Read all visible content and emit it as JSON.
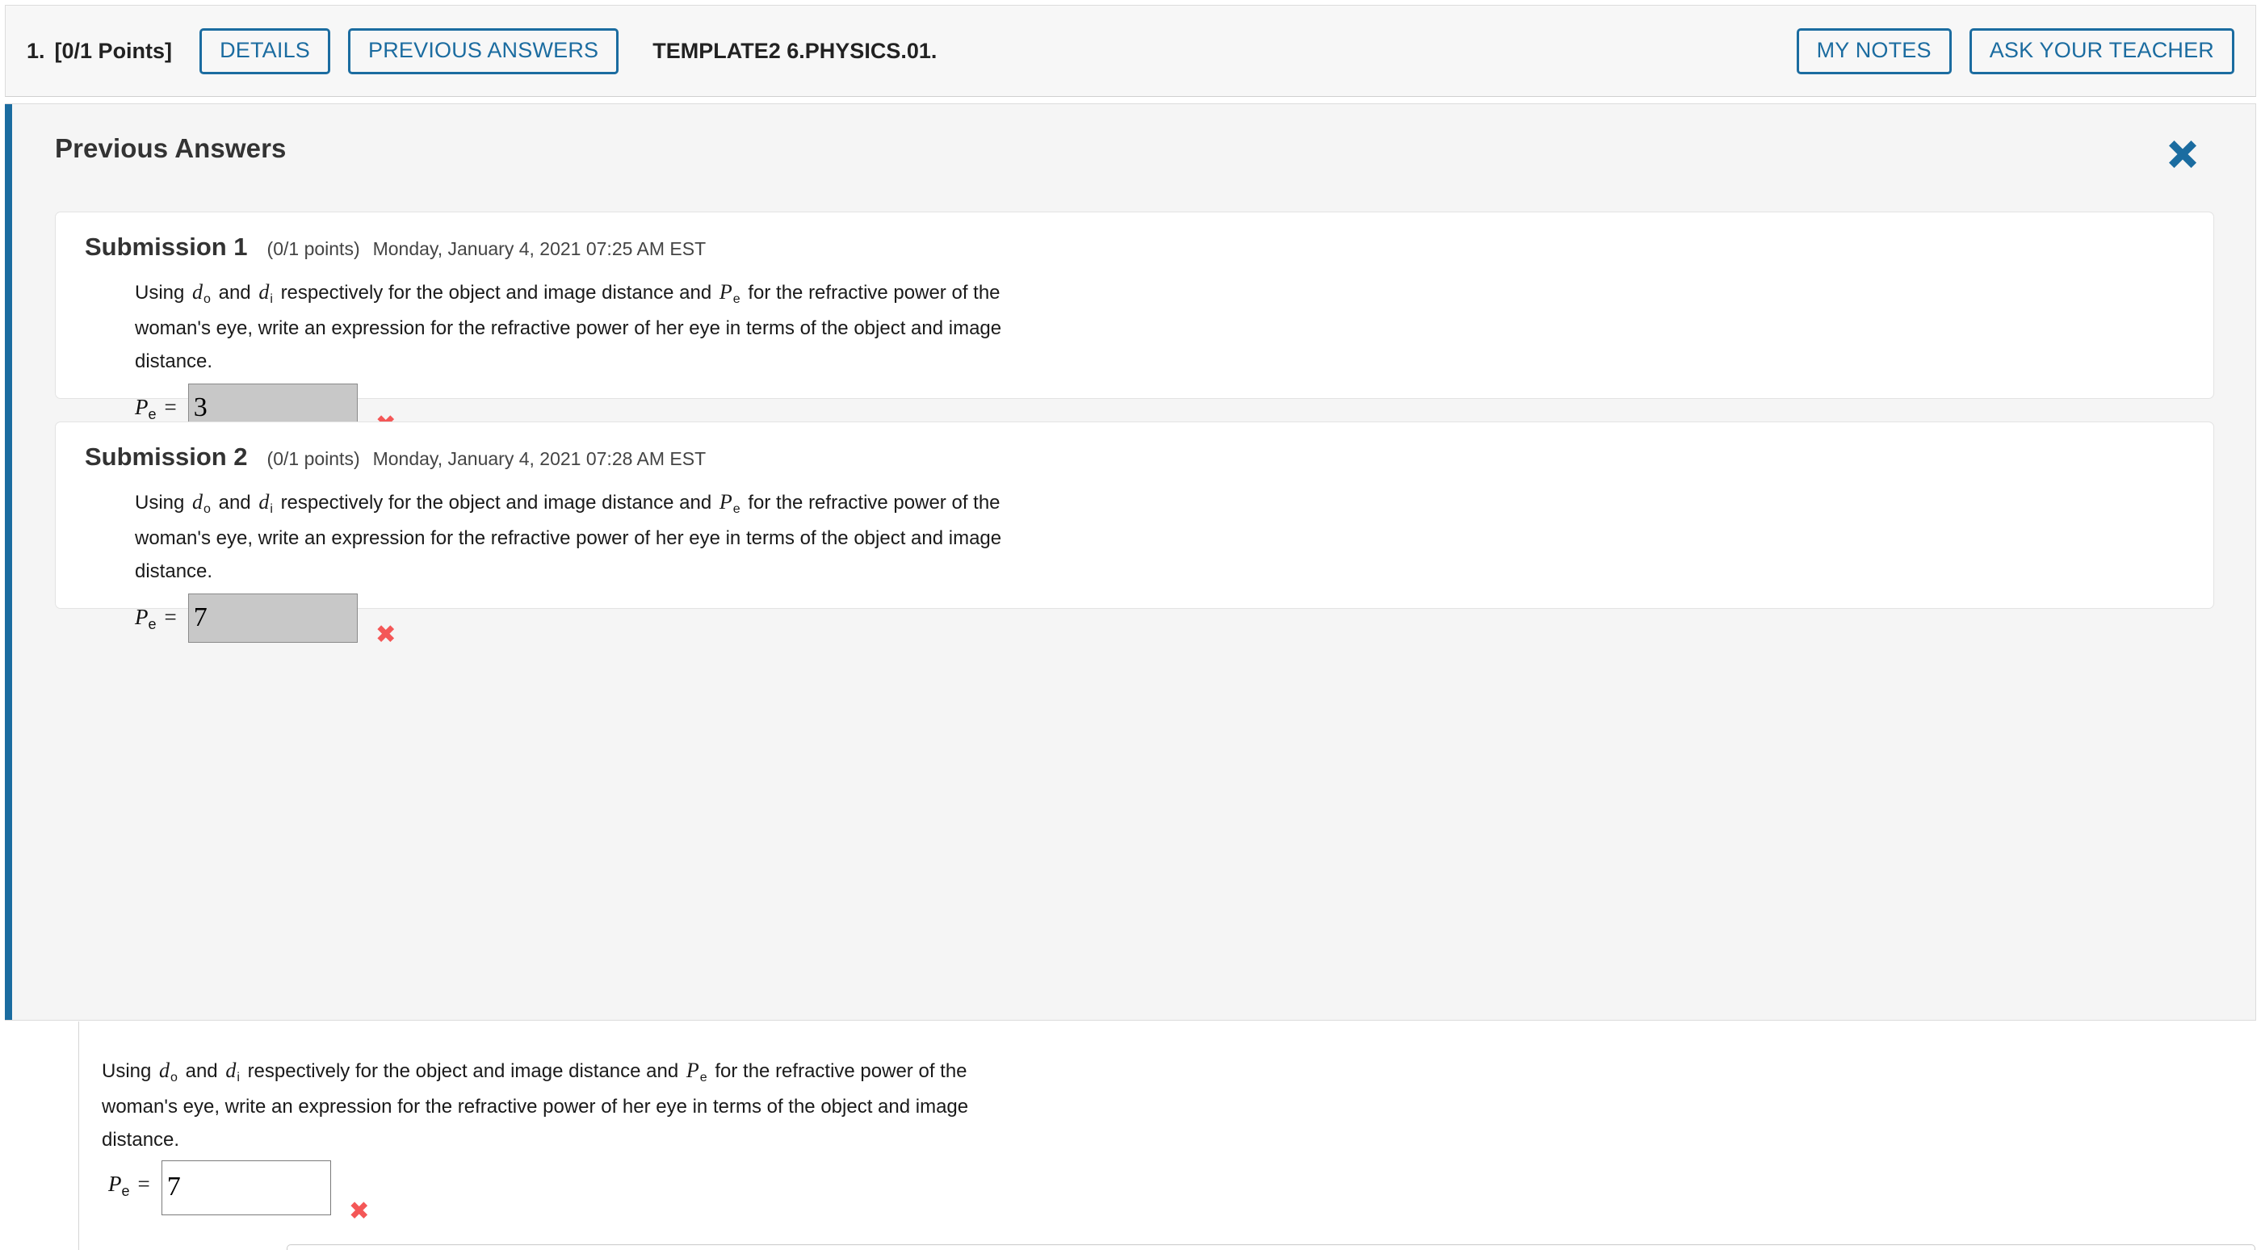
{
  "header": {
    "question_number": "1.",
    "points": "[0/1 Points]",
    "details_label": "DETAILS",
    "previous_answers_label": "PREVIOUS ANSWERS",
    "assignment_title": "TEMPLATE2 6.PHYSICS.01.",
    "my_notes_label": "MY NOTES",
    "ask_your_teacher_label": "ASK YOUR TEACHER"
  },
  "panel": {
    "title": "Previous Answers",
    "close_icon": "close-x-icon",
    "accent_color": "#1b6ca0"
  },
  "question": {
    "text_part1": "Using",
    "var_do": "d",
    "var_do_sub": "o",
    "text_part2": "and",
    "var_di": "d",
    "var_di_sub": "i",
    "text_part3": "respectively for the object and image distance and",
    "var_Pe": "P",
    "var_Pe_sub": "e",
    "text_part4": "for the refractive power of the woman's eye, write an expression for the refractive power of her eye in terms of the object and image distance.",
    "answer_label_var": "P",
    "answer_label_sub": "e",
    "answer_label_eq": "=",
    "wrong_mark": "✖"
  },
  "submissions": [
    {
      "label": "Submission 1",
      "points": "(0/1 points)",
      "timestamp": "Monday, January 4, 2021 07:25 AM EST",
      "answer_value": "3",
      "status": "incorrect"
    },
    {
      "label": "Submission 2",
      "points": "(0/1 points)",
      "timestamp": "Monday, January 4, 2021 07:28 AM EST",
      "answer_value": "7",
      "status": "incorrect"
    }
  ],
  "live_question": {
    "answer_value": "7",
    "status": "incorrect"
  },
  "colors": {
    "accent_blue": "#1b6ca0",
    "wrong_red": "#f45757",
    "panel_bg": "#f5f5f5",
    "header_bg": "#f7f7f7"
  }
}
